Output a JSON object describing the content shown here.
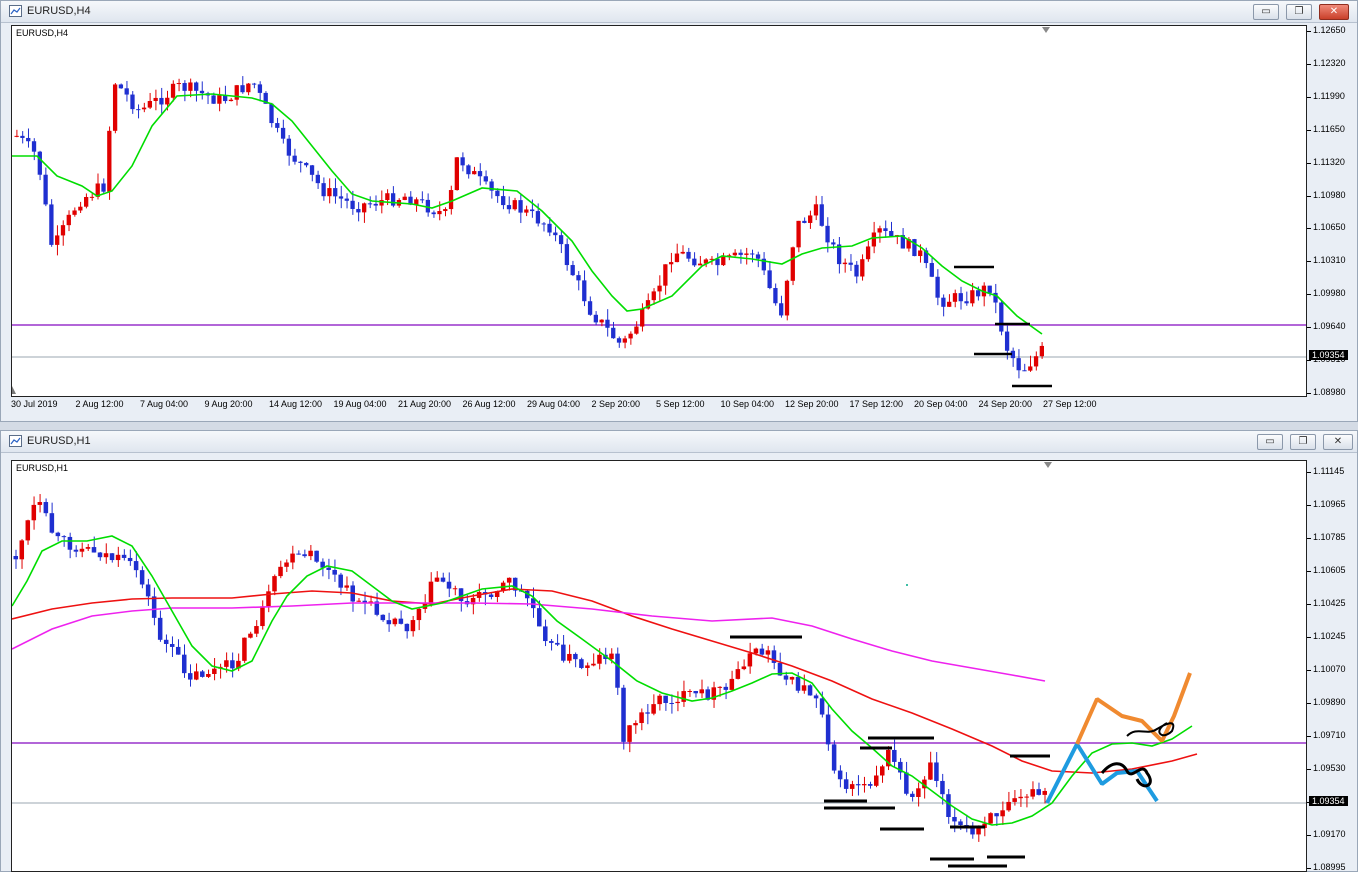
{
  "windows": [
    {
      "title": "EURUSD,H4",
      "symbol_label": "EURUSD,H4",
      "current_price": "1.09354",
      "price_ticks": [
        "1.12650",
        "1.12320",
        "1.11990",
        "1.11650",
        "1.11320",
        "1.10980",
        "1.10650",
        "1.10310",
        "1.09980",
        "1.09640",
        "1.09310",
        "1.08980"
      ],
      "time_ticks": [
        "30 Jul 2019",
        "2 Aug 12:00",
        "7 Aug 04:00",
        "9 Aug 20:00",
        "14 Aug 12:00",
        "19 Aug 04:00",
        "21 Aug 20:00",
        "26 Aug 12:00",
        "29 Aug 04:00",
        "2 Sep 20:00",
        "5 Sep 12:00",
        "10 Sep 04:00",
        "12 Sep 20:00",
        "17 Sep 12:00",
        "20 Sep 04:00",
        "24 Sep 20:00",
        "27 Sep 12:00"
      ],
      "colors": {
        "bull": "#e00000",
        "bear": "#1f2fd0",
        "ma": "#00dd00",
        "level": "#9933cc",
        "marks": "#000000"
      }
    },
    {
      "title": "EURUSD,H1",
      "symbol_label": "EURUSD,H1",
      "current_price": "1.09354",
      "price_ticks": [
        "1.11145",
        "1.10965",
        "1.10785",
        "1.10605",
        "1.10425",
        "1.10245",
        "1.10070",
        "1.09890",
        "1.09710",
        "1.09530",
        "1.09354",
        "1.09170",
        "1.08995"
      ],
      "colors": {
        "bull": "#e00000",
        "bear": "#1f2fd0",
        "ma_fast": "#00dd00",
        "ma_mid": "#ee1111",
        "ma_slow": "#ee22ee",
        "level": "#9933cc",
        "forecast_up": "#f08a30",
        "forecast_down": "#1e9be0"
      }
    }
  ],
  "icons": {
    "app": "chart-window-icon",
    "minimize": "minimize-icon",
    "maximize": "maximize-icon",
    "close": "close-icon"
  },
  "buttons": {
    "min": "▭",
    "max": "❐",
    "close": "✕"
  }
}
